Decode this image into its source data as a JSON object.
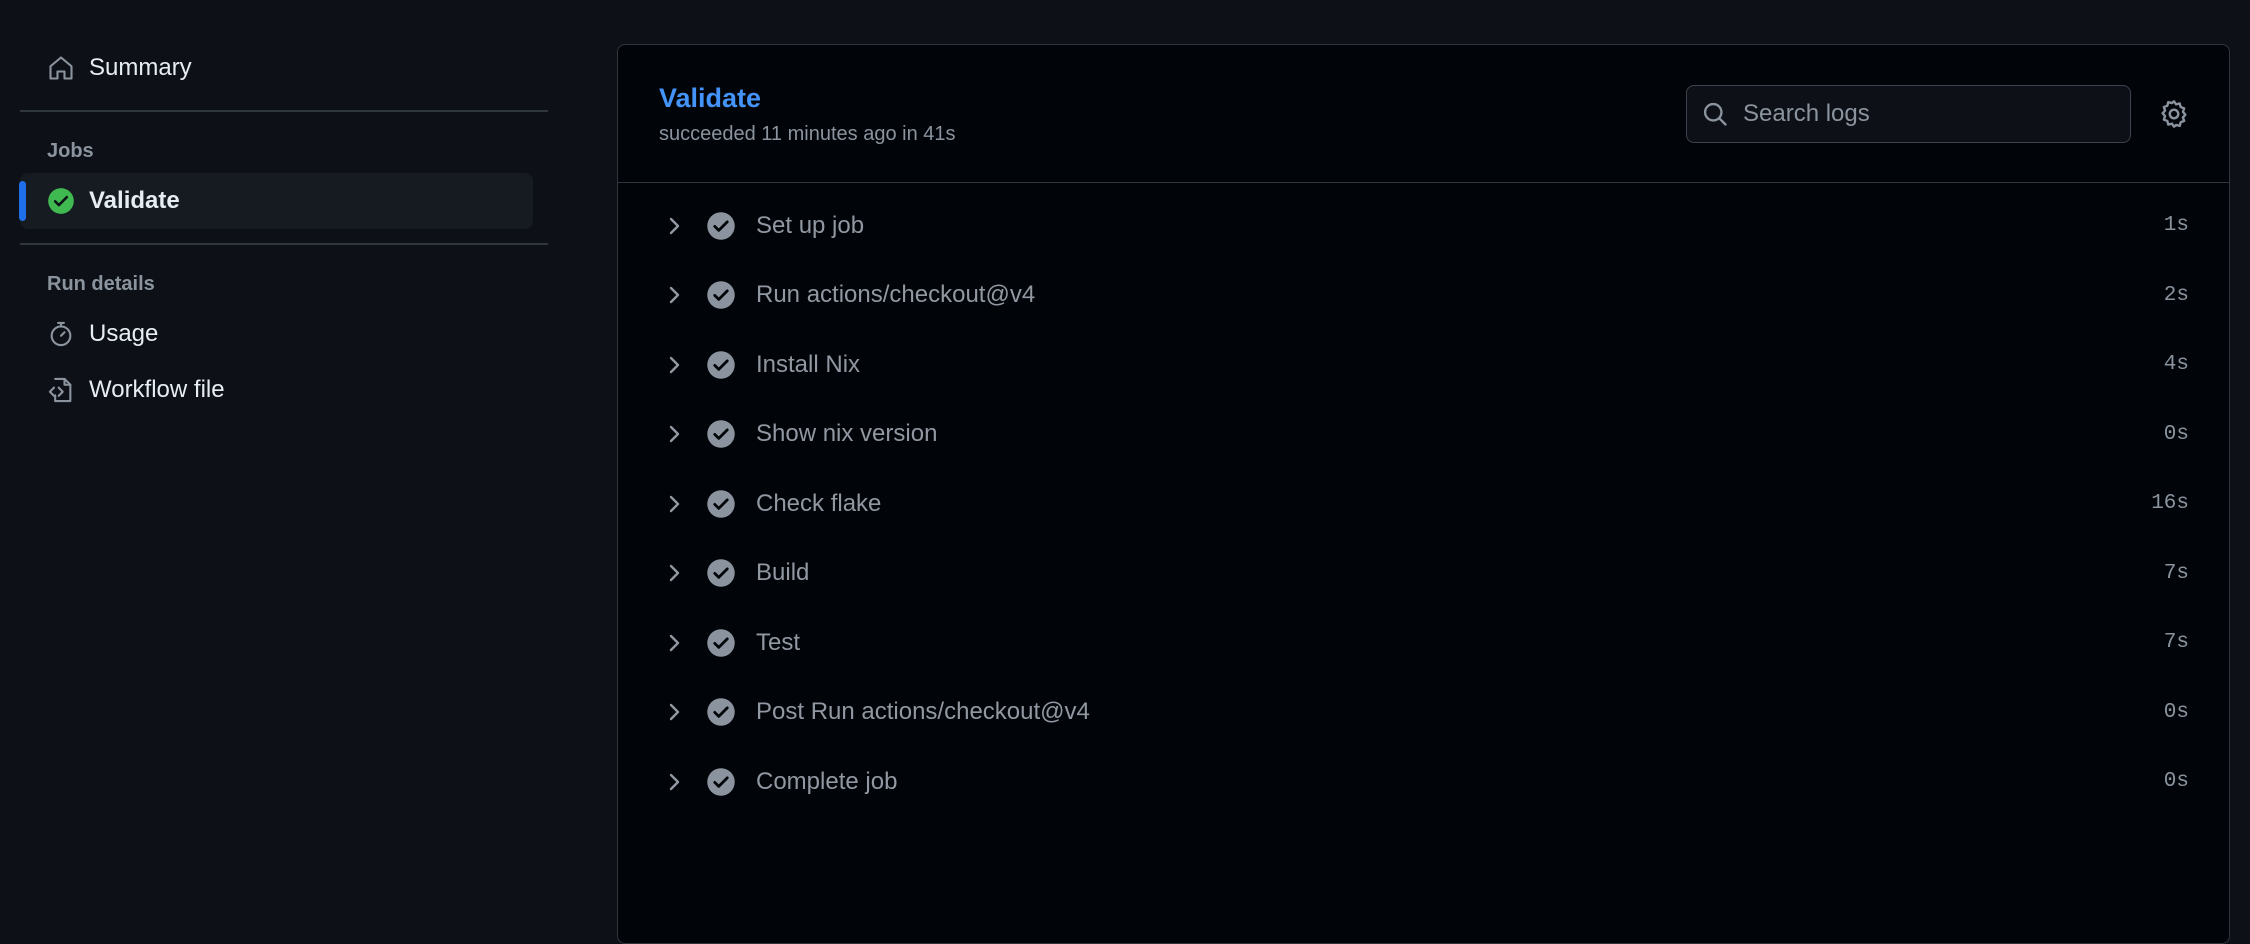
{
  "sidebar": {
    "summary_label": "Summary",
    "jobs_heading": "Jobs",
    "jobs": [
      {
        "label": "Validate",
        "status": "success"
      }
    ],
    "run_details_heading": "Run details",
    "usage_label": "Usage",
    "workflow_file_label": "Workflow file"
  },
  "job": {
    "title": "Validate",
    "subtitle": "succeeded 11 minutes ago in 41s"
  },
  "search": {
    "placeholder": "Search logs"
  },
  "steps": [
    {
      "name": "Set up job",
      "duration": "1s"
    },
    {
      "name": "Run actions/checkout@v4",
      "duration": "2s"
    },
    {
      "name": "Install Nix",
      "duration": "4s"
    },
    {
      "name": "Show nix version",
      "duration": "0s"
    },
    {
      "name": "Check flake",
      "duration": "16s"
    },
    {
      "name": "Build",
      "duration": "7s"
    },
    {
      "name": "Test",
      "duration": "7s"
    },
    {
      "name": "Post Run actions/checkout@v4",
      "duration": "0s"
    },
    {
      "name": "Complete job",
      "duration": "0s"
    }
  ],
  "colors": {
    "background": "#0d1117",
    "panel": "#010409",
    "accent_blue": "#4493f8",
    "success_green": "#3fb950",
    "step_check_gray": "#8b949e"
  }
}
